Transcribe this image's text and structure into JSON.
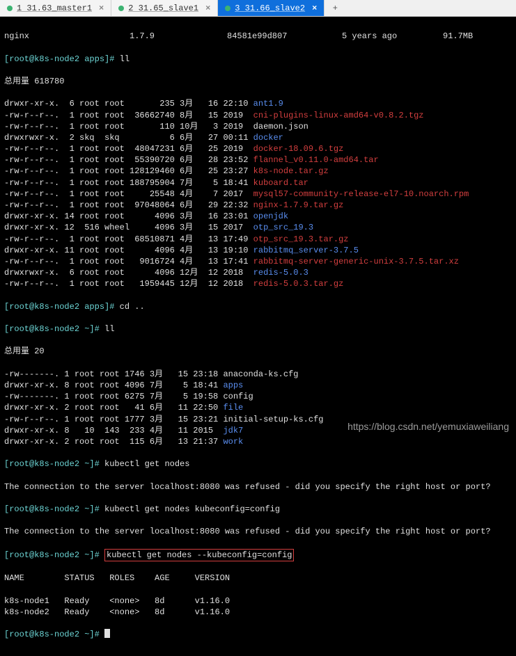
{
  "tabs": {
    "t1": "1 31.63_master1",
    "t2": "2 31.65_slave1",
    "t3": "3 31.66_slave2"
  },
  "header": {
    "name": "nginx",
    "ver": "1.7.9",
    "hash": "84581e99d807",
    "age": "5 years ago",
    "size": "91.7MB"
  },
  "prompt1": "[root@k8s-node2 apps]# ",
  "cmdll": "ll",
  "totala": "总用量 618780",
  "files_apps": [
    {
      "perm": "drwxr-xr-x.",
      "n": " 6",
      "u": "root",
      "g": "root",
      "sz": "      235",
      "m": "3月",
      "d": "  16",
      "t": "22:10",
      "name": "ant1.9",
      "cls": "blue"
    },
    {
      "perm": "-rw-r--r--.",
      "n": " 1",
      "u": "root",
      "g": "root",
      "sz": " 36662740",
      "m": "8月",
      "d": "  15",
      "t": "2019 ",
      "name": "cni-plugins-linux-amd64-v0.8.2.tgz",
      "cls": "red"
    },
    {
      "perm": "-rw-r--r--.",
      "n": " 1",
      "u": "root",
      "g": "root",
      "sz": "      110",
      "m": "10月",
      "d": "  3",
      "t": "2019 ",
      "name": "daemon.json",
      "cls": "w"
    },
    {
      "perm": "drwxrwxr-x.",
      "n": " 2",
      "u": "skq ",
      "g": "skq ",
      "sz": "        6",
      "m": "6月",
      "d": "  27",
      "t": "00:11",
      "name": "docker",
      "cls": "blue"
    },
    {
      "perm": "-rw-r--r--.",
      "n": " 1",
      "u": "root",
      "g": "root",
      "sz": " 48047231",
      "m": "6月",
      "d": "  25",
      "t": "2019 ",
      "name": "docker-18.09.6.tgz",
      "cls": "red"
    },
    {
      "perm": "-rw-r--r--.",
      "n": " 1",
      "u": "root",
      "g": "root",
      "sz": " 55390720",
      "m": "6月",
      "d": "  28",
      "t": "23:52",
      "name": "flannel_v0.11.0-amd64.tar",
      "cls": "red"
    },
    {
      "perm": "-rw-r--r--.",
      "n": " 1",
      "u": "root",
      "g": "root",
      "sz": "128129460",
      "m": "6月",
      "d": "  25",
      "t": "23:27",
      "name": "k8s-node.tar.gz",
      "cls": "red"
    },
    {
      "perm": "-rw-r--r--.",
      "n": " 1",
      "u": "root",
      "g": "root",
      "sz": "188795904",
      "m": "7月",
      "d": "   5",
      "t": "18:41",
      "name": "kuboard.tar",
      "cls": "red"
    },
    {
      "perm": "-rw-r--r--.",
      "n": " 1",
      "u": "root",
      "g": "root",
      "sz": "    25548",
      "m": "4月",
      "d": "   7",
      "t": "2017 ",
      "name": "mysql57-community-release-el7-10.noarch.rpm",
      "cls": "red"
    },
    {
      "perm": "-rw-r--r--.",
      "n": " 1",
      "u": "root",
      "g": "root",
      "sz": " 97048064",
      "m": "6月",
      "d": "  29",
      "t": "22:32",
      "name": "nginx-1.7.9.tar.gz",
      "cls": "red"
    },
    {
      "perm": "drwxr-xr-x.",
      "n": "14",
      "u": "root",
      "g": "root",
      "sz": "     4096",
      "m": "3月",
      "d": "  16",
      "t": "23:01",
      "name": "openjdk",
      "cls": "blue"
    },
    {
      "perm": "drwxr-xr-x.",
      "n": "12",
      "u": " 516",
      "g": "wheel",
      "sz": "    4096",
      "m": "3月",
      "d": "  15",
      "t": "2017 ",
      "name": "otp_src_19.3",
      "cls": "blue"
    },
    {
      "perm": "-rw-r--r--.",
      "n": " 1",
      "u": "root",
      "g": "root",
      "sz": " 68510871",
      "m": "4月",
      "d": "  13",
      "t": "17:49",
      "name": "otp_src_19.3.tar.gz",
      "cls": "red"
    },
    {
      "perm": "drwxr-xr-x.",
      "n": "11",
      "u": "root",
      "g": "root",
      "sz": "     4096",
      "m": "4月",
      "d": "  13",
      "t": "19:10",
      "name": "rabbitmq_server-3.7.5",
      "cls": "blue"
    },
    {
      "perm": "-rw-r--r--.",
      "n": " 1",
      "u": "root",
      "g": "root",
      "sz": "  9016724",
      "m": "4月",
      "d": "  13",
      "t": "17:41",
      "name": "rabbitmq-server-generic-unix-3.7.5.tar.xz",
      "cls": "red"
    },
    {
      "perm": "drwxrwxr-x.",
      "n": " 6",
      "u": "root",
      "g": "root",
      "sz": "     4096",
      "m": "12月",
      "d": " 12",
      "t": "2018 ",
      "name": "redis-5.0.3",
      "cls": "blue"
    },
    {
      "perm": "-rw-r--r--.",
      "n": " 1",
      "u": "root",
      "g": "root",
      "sz": "  1959445",
      "m": "12月",
      "d": " 12",
      "t": "2018 ",
      "name": "redis-5.0.3.tar.gz",
      "cls": "red"
    }
  ],
  "prompt2": "[root@k8s-node2 apps]# ",
  "cmdcd": "cd ..",
  "prompt3": "[root@k8s-node2 ~]# ",
  "totalb": "总用量 20",
  "files_home": [
    {
      "perm": "-rw-------.",
      "n": "1",
      "u": "root",
      "g": "root",
      "sz": "1746",
      "m": "3月",
      "d": "  15",
      "t": "23:18",
      "name": "anaconda-ks.cfg",
      "cls": "w"
    },
    {
      "perm": "drwxr-xr-x.",
      "n": "8",
      "u": "root",
      "g": "root",
      "sz": "4096",
      "m": "7月",
      "d": "   5",
      "t": "18:41",
      "name": "apps",
      "cls": "blue"
    },
    {
      "perm": "-rw-------.",
      "n": "1",
      "u": "root",
      "g": "root",
      "sz": "6275",
      "m": "7月",
      "d": "   5",
      "t": "19:58",
      "name": "config",
      "cls": "w"
    },
    {
      "perm": "drwxr-xr-x.",
      "n": "2",
      "u": "root",
      "g": "root",
      "sz": "  41",
      "m": "6月",
      "d": "  11",
      "t": "22:50",
      "name": "file",
      "cls": "blue"
    },
    {
      "perm": "-rw-r--r--.",
      "n": "1",
      "u": "root",
      "g": "root",
      "sz": "1777",
      "m": "3月",
      "d": "  15",
      "t": "23:21",
      "name": "initial-setup-ks.cfg",
      "cls": "w"
    },
    {
      "perm": "drwxr-xr-x.",
      "n": "8",
      "u": "  10",
      "g": " 143",
      "sz": " 233",
      "m": "4月",
      "d": "  11",
      "t": "2015 ",
      "name": "jdk7",
      "cls": "blue"
    },
    {
      "perm": "drwxr-xr-x.",
      "n": "2",
      "u": "root",
      "g": "root",
      "sz": " 115",
      "m": "6月",
      "d": "  13",
      "t": "21:37",
      "name": "work",
      "cls": "blue"
    }
  ],
  "cmd_getnodes": "kubectl get nodes",
  "err_line": "The connection to the server localhost:8080 was refused - did you specify the right host or port?",
  "cmd_getnodes2": "kubectl get nodes kubeconfig=config",
  "boxed_cmd": "kubectl get nodes --kubeconfig=config",
  "nodes_header": "NAME        STATUS   ROLES    AGE     VERSION",
  "nodes_rows": [
    "k8s-node1   Ready    <none>   8d      v1.16.0",
    "k8s-node2   Ready    <none>   8d      v1.16.0"
  ],
  "watermark": "https://blog.csdn.net/yemuxiaweiliang"
}
